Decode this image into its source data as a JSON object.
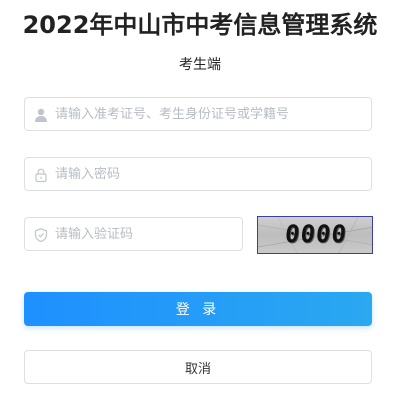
{
  "header": {
    "title": "2022年中山市中考信息管理系统",
    "subtitle": "考生端"
  },
  "form": {
    "username_placeholder": "请输入准考证号、考生身份证号或学籍号",
    "username_value": "",
    "username_icon": "user-icon",
    "password_placeholder": "请输入密码",
    "password_value": "",
    "password_icon": "lock-icon",
    "captcha_placeholder": "请输入验证码",
    "captcha_value": "",
    "captcha_icon": "shield-icon",
    "captcha_image_text": "0000"
  },
  "actions": {
    "login_label": "登 录",
    "cancel_label": "取消"
  },
  "colors": {
    "primary": "#1e90ff",
    "border": "#dcdfe6",
    "placeholder": "#b7bcc4",
    "captcha_border": "#3a3fa0"
  }
}
